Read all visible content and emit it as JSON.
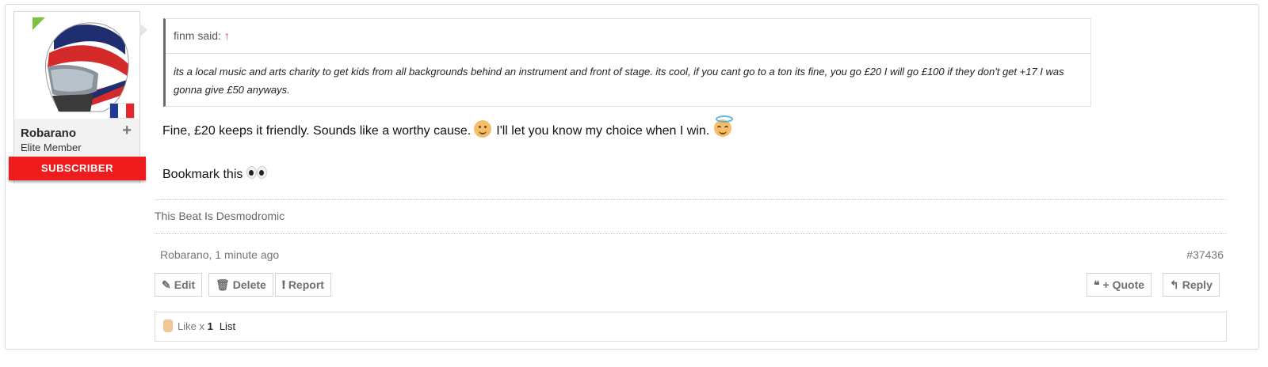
{
  "user": {
    "name": "Robarano",
    "title": "Elite Member",
    "badge": "SUBSCRIBER",
    "follow_icon": "+",
    "flag": "france-flag-icon"
  },
  "quote": {
    "author": "finm said:",
    "arrow": "↑",
    "text": "its a local music and arts charity to get kids from all backgrounds behind an instrument and front of stage. its cool, if you cant go to a ton its fine, you go £20 I will go £100 if they don't get +17 I was gonna give £50 anyways."
  },
  "message": {
    "line1_a": "Fine, £20 keeps it friendly. Sounds like a worthy cause.",
    "line1_b": "I'll let you know my choice when I win.",
    "line2": "Bookmark this"
  },
  "signature": "This Beat Is Desmodromic",
  "meta": {
    "author_time": "Robarano, 1 minute ago",
    "post_number": "#37436"
  },
  "actions": {
    "edit": "Edit",
    "delete": "Delete",
    "report": "Report",
    "quote": "+ Quote",
    "reply": "Reply"
  },
  "likes": {
    "prefix": "Like x",
    "count": "1",
    "list": "List"
  },
  "colors": {
    "subscriber_red": "#ee1c1c",
    "online_green": "#7fc242",
    "quote_arrow": "#dd3333"
  }
}
